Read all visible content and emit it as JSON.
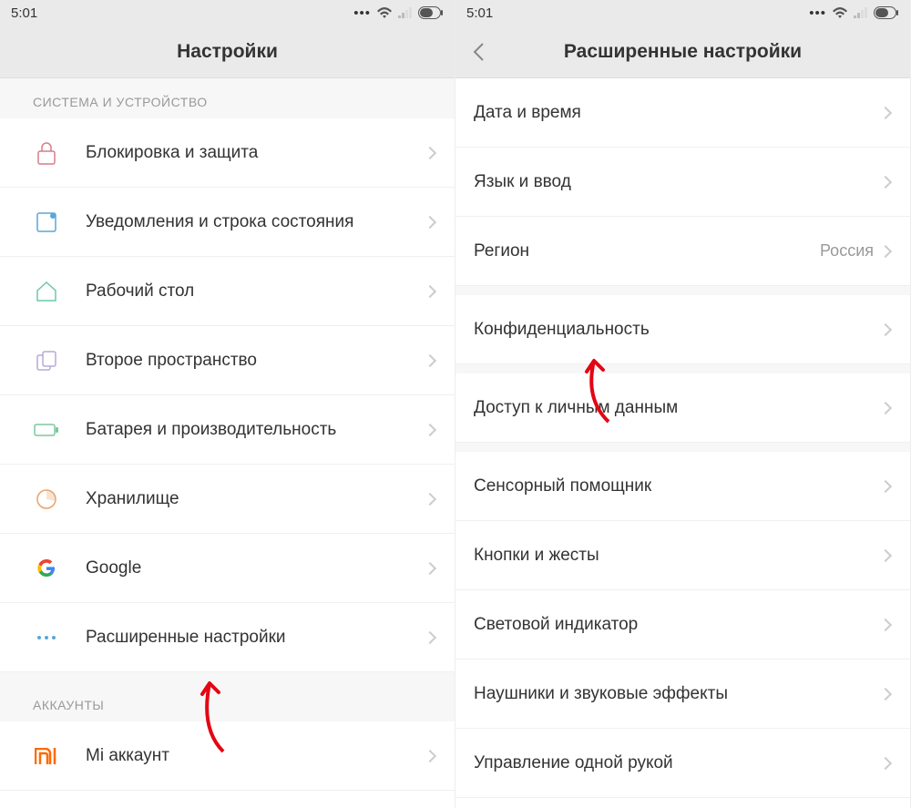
{
  "status": {
    "time": "5:01"
  },
  "left": {
    "title": "Настройки",
    "section1": "СИСТЕМА И УСТРОЙСТВО",
    "section2": "АККАУНТЫ",
    "items": [
      {
        "label": "Блокировка и защита"
      },
      {
        "label": "Уведомления и строка состояния"
      },
      {
        "label": "Рабочий стол"
      },
      {
        "label": "Второе пространство"
      },
      {
        "label": "Батарея и производительность"
      },
      {
        "label": "Хранилище"
      },
      {
        "label": "Google"
      },
      {
        "label": "Расширенные настройки"
      }
    ],
    "accounts": [
      {
        "label": "Mi аккаунт"
      }
    ]
  },
  "right": {
    "title": "Расширенные настройки",
    "items": [
      {
        "label": "Дата и время"
      },
      {
        "label": "Язык и ввод"
      },
      {
        "label": "Регион",
        "value": "Россия"
      },
      {
        "label": "Конфиденциальность"
      },
      {
        "label": "Доступ к личным данным"
      },
      {
        "label": "Сенсорный помощник"
      },
      {
        "label": "Кнопки и жесты"
      },
      {
        "label": "Световой индикатор"
      },
      {
        "label": "Наушники и звуковые эффекты"
      },
      {
        "label": "Управление одной рукой"
      }
    ]
  }
}
